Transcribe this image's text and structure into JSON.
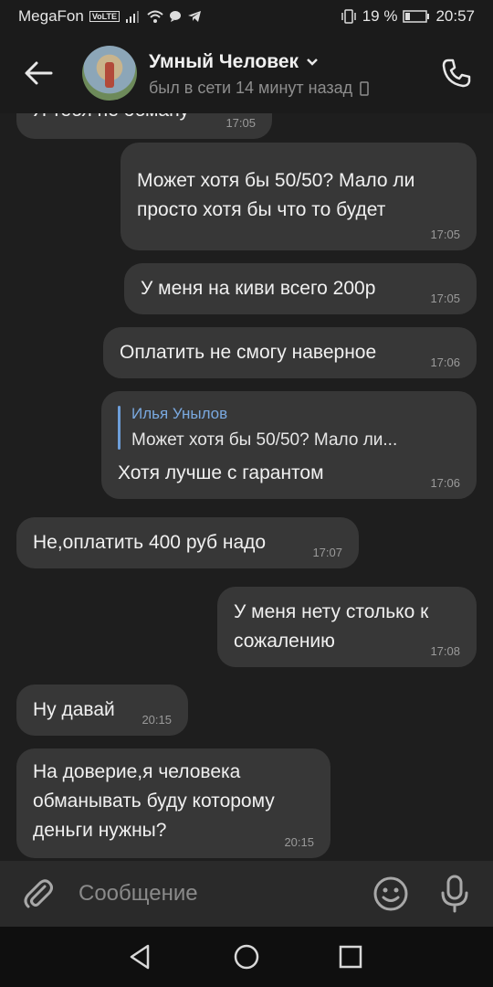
{
  "status_bar": {
    "carrier": "MegaFon",
    "volte": "VoLTE",
    "battery_percent": "19 %",
    "time": "20:57"
  },
  "header": {
    "contact_name": "Умный Человек",
    "last_seen": "был в сети 14 минут назад"
  },
  "messages": [
    {
      "direction": "in",
      "text": "Я тебя не обману",
      "time": "17:05"
    },
    {
      "direction": "out",
      "text": "Может хотя бы 50/50? Мало ли просто хотя бы что то будет",
      "time": "17:05"
    },
    {
      "direction": "out",
      "text": "У меня на киви всего 200р",
      "time": "17:05"
    },
    {
      "direction": "out",
      "text": "Оплатить не смогу наверное",
      "time": "17:06"
    },
    {
      "direction": "out",
      "reply_to_name": "Илья Унылов",
      "reply_to_text": "Может хотя бы 50/50? Мало ли...",
      "text": "Хотя лучше с гарантом",
      "time": "17:06"
    },
    {
      "direction": "in",
      "text": "Не,оплатить 400 руб надо",
      "time": "17:07"
    },
    {
      "direction": "out",
      "text": "У меня нету столько к сожалению",
      "time": "17:08"
    },
    {
      "direction": "in",
      "text": "Ну давай",
      "time": "20:15"
    },
    {
      "direction": "in",
      "text": "На доверие,я человека обманывать буду которому деньги нужны?",
      "time": "20:15"
    }
  ],
  "composer": {
    "placeholder": "Сообщение"
  },
  "icons": {
    "back": "arrow-left-icon",
    "phone": "phone-icon",
    "attach": "paperclip-icon",
    "emoji": "smiley-icon",
    "mic": "microphone-icon",
    "nav_back": "triangle-back-icon",
    "nav_home": "circle-home-icon",
    "nav_recent": "square-recent-icon"
  },
  "colors": {
    "background": "#1e1e1e",
    "bubble": "#373737",
    "reply_accent": "#7aa9e0"
  }
}
